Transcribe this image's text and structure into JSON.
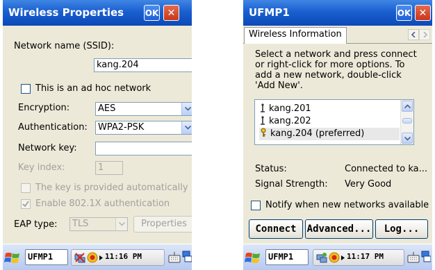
{
  "left": {
    "title": "Wireless Properties",
    "ok_label": "OK",
    "close_label": "✕",
    "ssid_label": "Network name (SSID):",
    "ssid_value": "kang.204",
    "adhoc_label": "This is an ad hoc network",
    "adhoc_checked": false,
    "encryption_label": "Encryption:",
    "encryption_value": "AES",
    "authentication_label": "Authentication:",
    "authentication_value": "WPA2-PSK",
    "network_key_label": "Network key:",
    "network_key_value": "",
    "key_index_label": "Key index:",
    "key_index_value": "1",
    "auto_key_label": "The key is provided automatically",
    "auto_key_checked": false,
    "dot1x_label": "Enable 802.1X authentication",
    "dot1x_checked": true,
    "eap_label": "EAP type:",
    "eap_value": "TLS",
    "properties_label": "Properties",
    "taskbar": {
      "task_label": "UFMP1",
      "time": "11:16 PM"
    }
  },
  "right": {
    "title": "UFMP1",
    "ok_label": "OK",
    "close_label": "✕",
    "tab_label": "Wireless Information",
    "instructions": "Select a network and press connect or right-click for more options.  To add a new network, double-click 'Add New'.",
    "instruction_lines": [
      "Select a network and press connect",
      "or right-click for more options.  To",
      "add a new network, double-click",
      "'Add New'."
    ],
    "networks": [
      {
        "name": "kang.201",
        "icon": "antenna-icon",
        "selected": false
      },
      {
        "name": "kang.202",
        "icon": "antenna-icon",
        "selected": false
      },
      {
        "name": "kang.204 (preferred)",
        "icon": "key-icon",
        "selected": true
      }
    ],
    "status_label": "Status:",
    "status_value": "Connected to ka...",
    "signal_label": "Signal Strength:",
    "signal_value": "Very Good",
    "notify_label": "Notify when new networks available",
    "notify_checked": false,
    "connect_label": "Connect",
    "advanced_label": "Advanced...",
    "log_label": "Log...",
    "taskbar": {
      "task_label": "UFMP1",
      "time": "11:17 PM"
    }
  },
  "colors": {
    "titlebar": "#1a5fd0",
    "dialog_bg": "#ece9d8",
    "close_button": "#c8361a",
    "disabled_text": "#a0a0a0"
  }
}
